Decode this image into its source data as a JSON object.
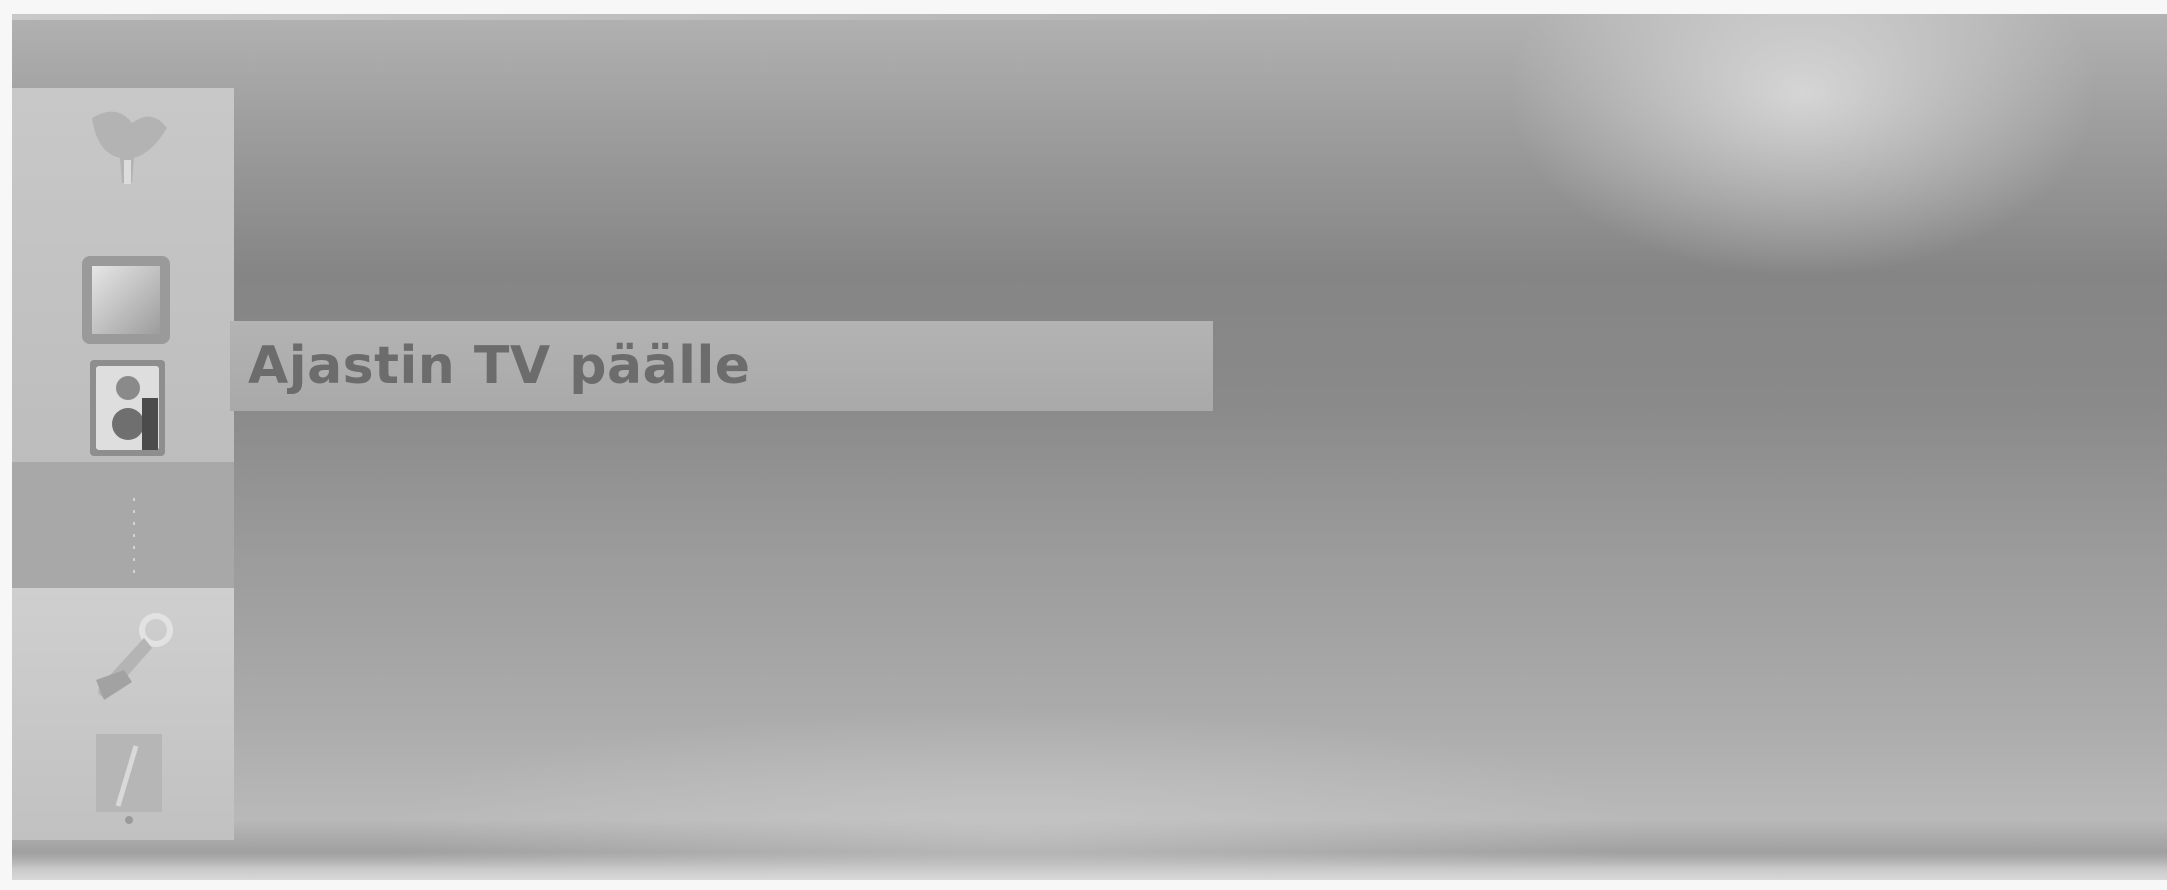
{
  "menu": {
    "selected_item": "Ajastin TV päälle"
  },
  "sidebar": {
    "icons": [
      "antenna-icon",
      "picture-icon",
      "timer-icon",
      "audio-icon",
      "settings-icon",
      "clock-icon"
    ]
  },
  "colors": {
    "background": "#8a8a8a",
    "sidebar": "#c4c4c4",
    "highlight_bar": "#aeaeae",
    "label_text": "#6c6c6c"
  }
}
